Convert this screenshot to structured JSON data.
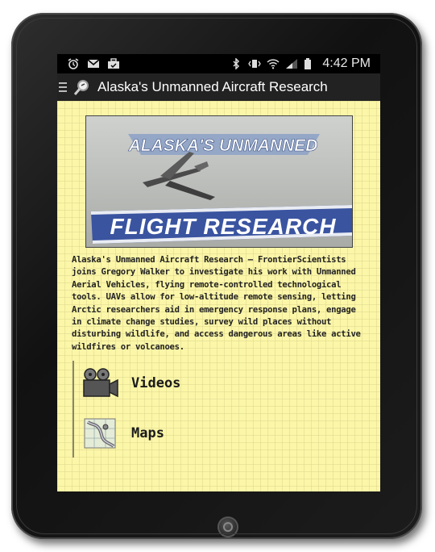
{
  "status_bar": {
    "time": "4:42 PM",
    "left_icons": [
      "alarm-icon",
      "gmail-icon",
      "briefcase-icon"
    ],
    "right_icons": [
      "bluetooth-icon",
      "vibrate-icon",
      "wifi-icon",
      "signal-icon",
      "battery-icon"
    ]
  },
  "action_bar": {
    "title": "Alaska's Unmanned Aircraft Research",
    "menu_icon": "hamburger-icon",
    "logo_icon": "magnifier-logo-icon"
  },
  "banner": {
    "top_text": "ALASKA'S UNMANNED",
    "bottom_text": "FLIGHT RESEARCH"
  },
  "description": "Alaska's Unmanned Aircraft Research – FrontierScientists joins Gregory Walker to investigate his work with Unmanned Aerial Vehicles, flying remote-controlled technological tools. UAVs allow for low-altitude remote sensing, letting Arctic researchers aid in emergency response plans, engage in climate change studies, survey wild places without disturbing wildlife, and access dangerous areas like active wildfires or volcanoes.",
  "menu": [
    {
      "label": "Videos",
      "icon": "video-camera-icon"
    },
    {
      "label": "Maps",
      "icon": "map-icon"
    }
  ],
  "colors": {
    "paper": "#fbf6a8",
    "action_bar": "#222222",
    "banner_blue": "#3a54a0"
  }
}
